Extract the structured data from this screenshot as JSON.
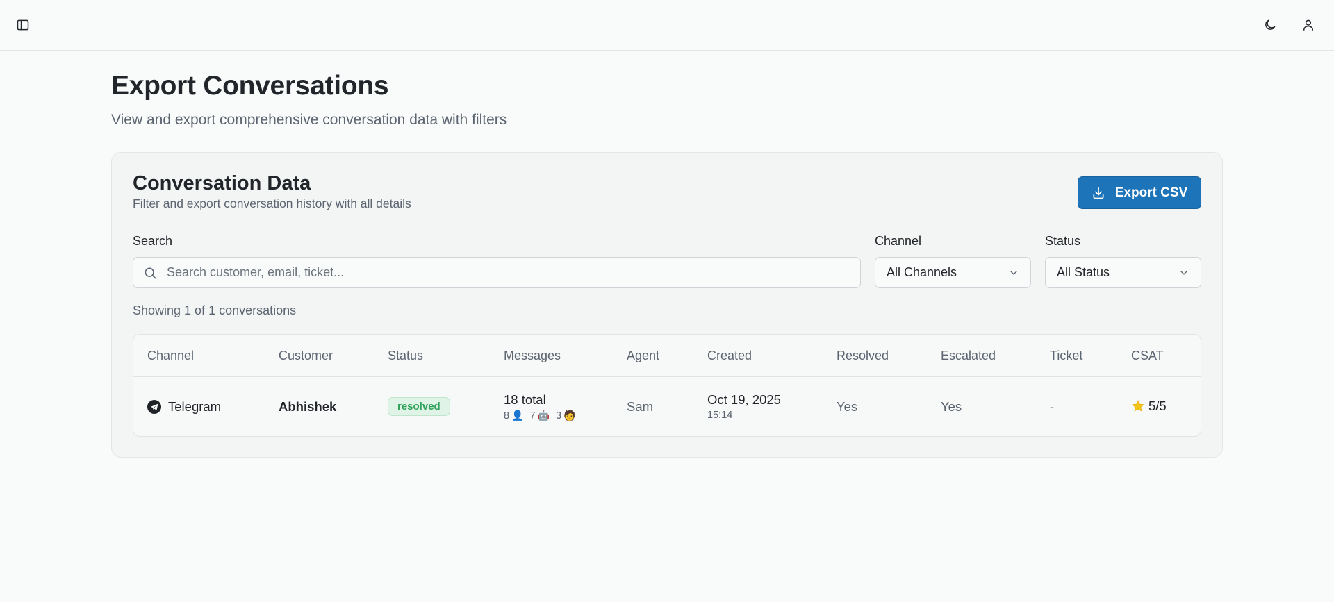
{
  "header": {
    "sidebar_toggle_icon": "sidebar-panel-icon",
    "theme_icon": "moon-icon",
    "user_icon": "user-icon"
  },
  "page": {
    "title": "Export Conversations",
    "subtitle": "View and export comprehensive conversation data with filters"
  },
  "card": {
    "title": "Conversation Data",
    "description": "Filter and export conversation history with all details",
    "export_label": "Export CSV"
  },
  "filters": {
    "search_label": "Search",
    "search_placeholder": "Search customer, email, ticket...",
    "search_value": "",
    "channel_label": "Channel",
    "channel_value": "All Channels",
    "status_label": "Status",
    "status_value": "All Status"
  },
  "summary": {
    "count_text": "Showing 1 of 1 conversations"
  },
  "table": {
    "headers": [
      "Channel",
      "Customer",
      "Status",
      "Messages",
      "Agent",
      "Created",
      "Resolved",
      "Escalated",
      "Ticket",
      "CSAT"
    ],
    "rows": [
      {
        "channel": "Telegram",
        "customer": "Abhishek",
        "status": "resolved",
        "messages_total": "18 total",
        "messages_user": "8",
        "messages_bot": "7",
        "messages_agent": "3",
        "agent": "Sam",
        "created_date": "Oct 19, 2025",
        "created_time": "15:14",
        "resolved": "Yes",
        "escalated": "Yes",
        "ticket": "-",
        "csat": "5/5"
      }
    ]
  },
  "colors": {
    "accent": "#1e74b8",
    "status_resolved_bg": "#dff3e6",
    "status_resolved_text": "#2fa35a",
    "star": "#f5c518"
  }
}
